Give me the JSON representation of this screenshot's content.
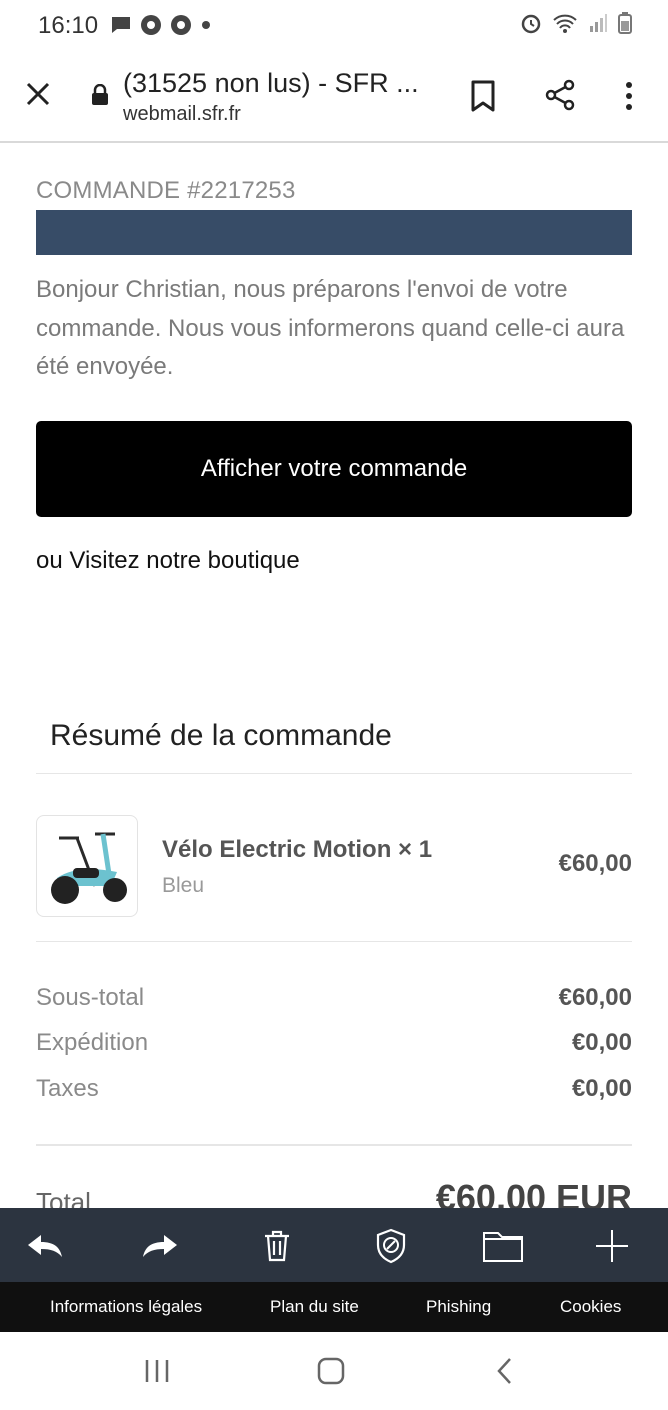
{
  "status_bar": {
    "time": "16:10"
  },
  "browser": {
    "page_title": "(31525 non lus) - SFR ...",
    "domain": "webmail.sfr.fr"
  },
  "email": {
    "order_number": "COMMANDE #2217253",
    "greeting": "Bonjour Christian, nous préparons l'envoi de votre commande. Nous vous informerons quand celle-ci aura été envoyée.",
    "view_order_button": "Afficher votre commande",
    "visit_prefix": "ou",
    "visit_link": "Visitez notre boutique",
    "accent_color": "#374c67"
  },
  "summary": {
    "title": "Résumé de la commande",
    "product": {
      "name": "Vélo Electric Motion × 1",
      "variant": "Bleu",
      "price": "€60,00"
    },
    "rows": [
      {
        "label": "Sous-total",
        "value": "€60,00"
      },
      {
        "label": "Expédition",
        "value": "€0,00"
      },
      {
        "label": "Taxes",
        "value": "€0,00"
      }
    ],
    "total_label": "Total",
    "total_value": "€60,00 EUR"
  },
  "toolbar": {
    "icons": [
      "reply-icon",
      "forward-icon",
      "trash-icon",
      "shield-icon",
      "folder-icon",
      "plus-icon"
    ]
  },
  "footer": {
    "links": [
      "Informations légales",
      "Plan du site",
      "Phishing",
      "Cookies"
    ]
  }
}
